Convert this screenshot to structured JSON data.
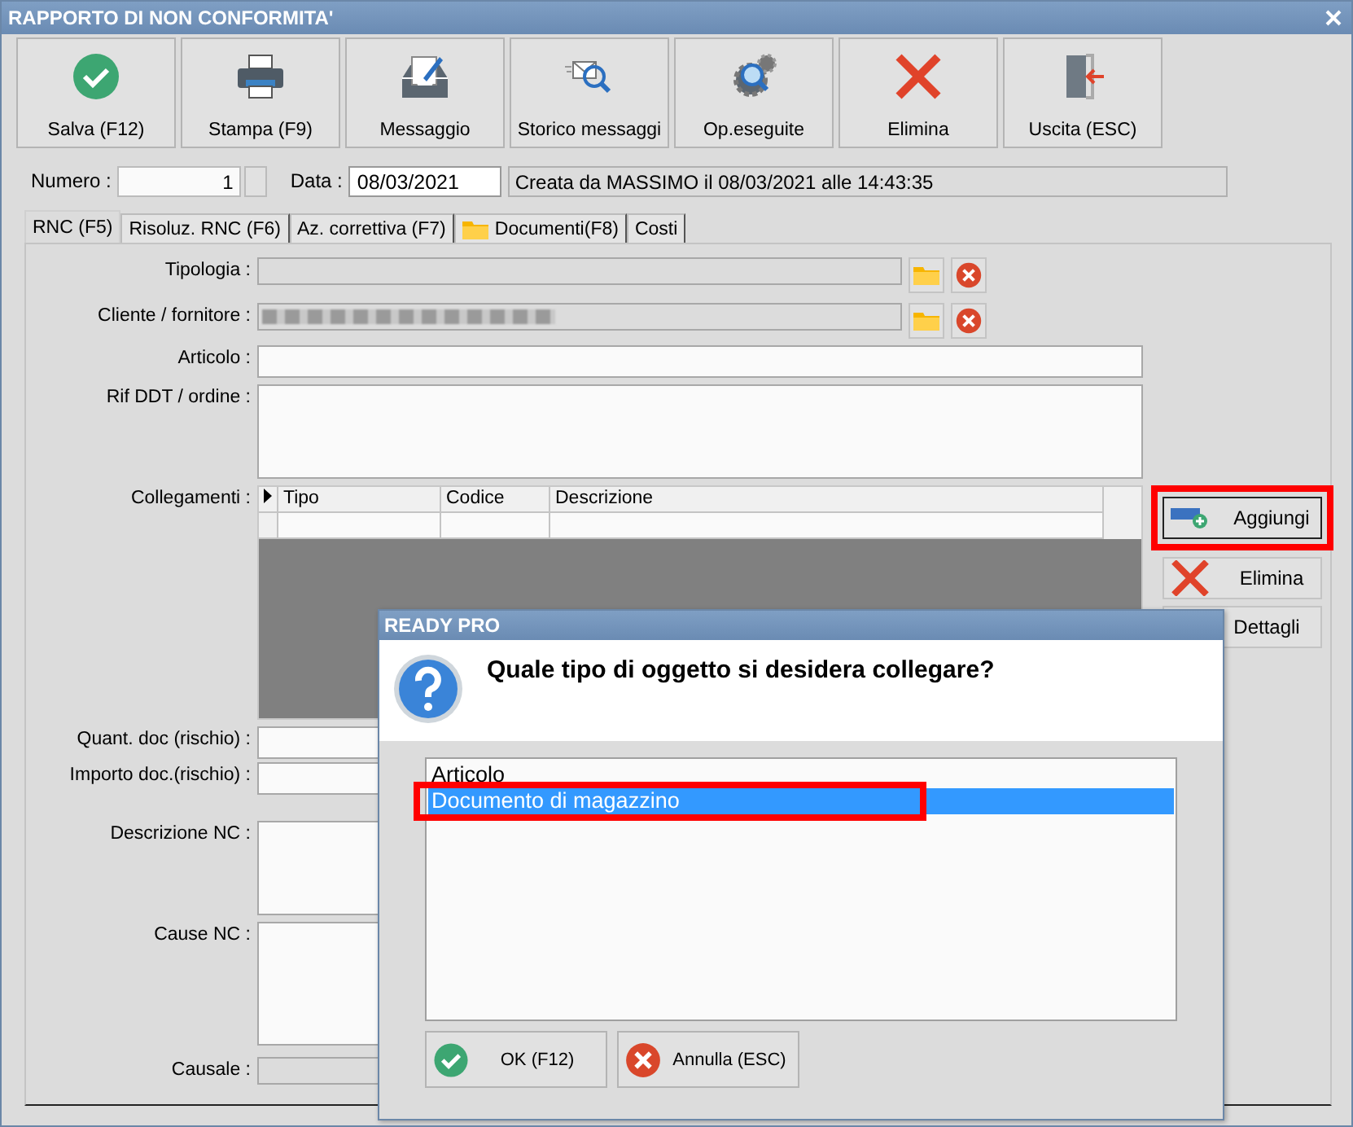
{
  "window": {
    "title": "RAPPORTO DI NON CONFORMITA'"
  },
  "toolbar": [
    {
      "label": "Salva (F12)",
      "kind": "save"
    },
    {
      "label": "Stampa (F9)",
      "kind": "print"
    },
    {
      "label": "Messaggio",
      "kind": "message"
    },
    {
      "label": "Storico messaggi",
      "kind": "history"
    },
    {
      "label": "Op.eseguite",
      "kind": "operations"
    },
    {
      "label": "Elimina",
      "kind": "delete"
    },
    {
      "label": "Uscita (ESC)",
      "kind": "exit"
    }
  ],
  "header": {
    "number_label": "Numero :",
    "number_value": "1",
    "date_label": "Data :",
    "date_value": "08/03/2021",
    "info": "Creata da MASSIMO il 08/03/2021 alle 14:43:35"
  },
  "tabs": [
    {
      "label": "RNC (F5)",
      "selected": true,
      "kind": "plain"
    },
    {
      "label": "Risoluz. RNC (F6)",
      "selected": false,
      "kind": "plain"
    },
    {
      "label": "Az. correttiva (F7)",
      "selected": false,
      "kind": "plain"
    },
    {
      "label": "Documenti(F8)",
      "selected": false,
      "kind": "folder"
    },
    {
      "label": "Costi",
      "selected": false,
      "kind": "plain"
    }
  ],
  "form": {
    "rows": [
      {
        "label": "Tipologia :",
        "kind": "lookup",
        "obscured": false
      },
      {
        "label": "Cliente / fornitore :",
        "kind": "lookup",
        "obscured": true
      },
      {
        "label": "Articolo :",
        "kind": "text"
      },
      {
        "label": "Rif DDT / ordine :",
        "kind": "memo"
      },
      {
        "label": "Collegamenti :",
        "kind": "links"
      },
      {
        "label": "Quant. doc (rischio) :",
        "kind": "text"
      },
      {
        "label": "Importo doc.(rischio) :",
        "kind": "text"
      },
      {
        "label": "Descrizione NC :",
        "kind": "memo"
      },
      {
        "label": "Cause NC :",
        "kind": "tallmemo"
      },
      {
        "label": "Causale :",
        "kind": "readonly"
      }
    ],
    "links": {
      "columns": [
        "Tipo",
        "Codice",
        "Descrizione"
      ],
      "buttons": [
        {
          "label": "Aggiungi",
          "kind": "add",
          "highlighted": true
        },
        {
          "label": "Elimina",
          "kind": "delete",
          "highlighted": false
        },
        {
          "label": "Dettagli",
          "kind": "details",
          "highlighted": false
        }
      ]
    }
  },
  "dialog": {
    "title": "READY PRO",
    "question": "Quale tipo di oggetto si desidera collegare?",
    "options": [
      {
        "label": "Articolo",
        "selected": false,
        "highlighted": false
      },
      {
        "label": "Documento di magazzino",
        "selected": true,
        "highlighted": true
      }
    ],
    "buttons": [
      {
        "label": "OK (F12)",
        "kind": "ok"
      },
      {
        "label": "Annulla (ESC)",
        "kind": "cancel"
      }
    ]
  }
}
